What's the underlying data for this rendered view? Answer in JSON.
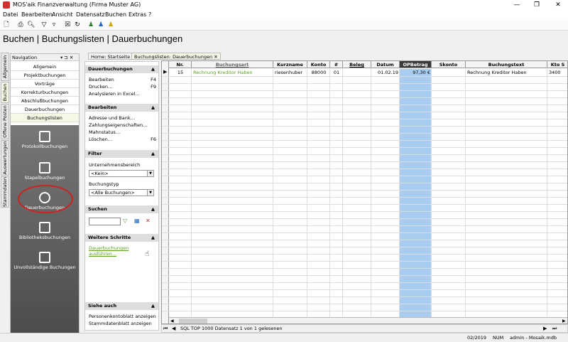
{
  "window": {
    "title": "MOS'aik Finanzverwaltung (Firma Muster AG)"
  },
  "menu": [
    "Datei",
    "Bearbeiten",
    "Ansicht",
    "Datensatz",
    "Buchen",
    "Extras",
    "?"
  ],
  "page_title": "Buchen | Buchungslisten | Dauerbuchungen",
  "vertical_tabs": [
    "Allgemein",
    "Buchen",
    "Offene Posten",
    "Auswertungen",
    "Stammdaten"
  ],
  "nav": {
    "header": "Navigation",
    "pin": "▾ ⊐ ✕",
    "items": [
      "Allgemein",
      "Projektbuchungen",
      "Vorträge",
      "Korrekturbuchungen",
      "Abschlußbuchungen",
      "Dauerbuchungen",
      "Buchungslisten"
    ],
    "big_items": [
      "Protokollbuchungen",
      "Stapelbuchungen",
      "Dauerbuchungen",
      "Bibliotheksbuchungen",
      "Unvollständige Buchungen"
    ]
  },
  "tabs": [
    "Home: Startseite",
    "Buchungslisten: Dauerbuchungen ✕"
  ],
  "actions": {
    "sec1": "Dauerbuchungen",
    "bearbeiten": "Bearbeiten",
    "bearbeiten_key": "F4",
    "drucken": "Drucken…",
    "drucken_key": "F9",
    "analysieren": "Analysieren in Excel…",
    "sec2": "Bearbeiten",
    "adresse": "Adresse und Bank…",
    "zahlung": "Zahlungseigenschaften…",
    "mahn": "Mahnstatus…",
    "loeschen": "Löschen…",
    "loeschen_key": "F6",
    "sec3": "Filter",
    "ub_label": "Unternehmensbereich",
    "ub_value": "<Kein>",
    "bt_label": "Buchungstyp",
    "bt_value": "<Alle Buchungen>",
    "sec4": "Suchen",
    "sec5": "Weitere Schritte",
    "ausfuehren": "Dauerbuchungen ausführen…",
    "sec6": "Siehe auch",
    "personen": "Personenkontoblatt anzeigen",
    "stamm": "Stammdatenblatt anzeigen",
    "caret": "▲"
  },
  "grid": {
    "columns": [
      "Nr.",
      "Buchungsart",
      "Kurzname",
      "Konto",
      "#",
      "Beleg",
      "Datum",
      "OPBetrag",
      "Skonto",
      "Buchungstext",
      "Kto S"
    ],
    "row": [
      "15",
      "Rechnung Kreditor Haben",
      "riesenhuber",
      "88000",
      "01",
      "",
      "01.02.19",
      "97,30 €",
      "",
      "Rechnung Kreditor Haben",
      "3400"
    ]
  },
  "status_text": "SQL TOP 1000 Datensatz 1 von 1 gelesenen",
  "bottom": {
    "period": "02/2019",
    "num": "NUM",
    "user": "admin - Mosaik.mdb"
  },
  "colors": {
    "accent_green": "#5a9e1a",
    "op_highlight": "#a9cdf1",
    "annotation_red": "#d02020"
  }
}
